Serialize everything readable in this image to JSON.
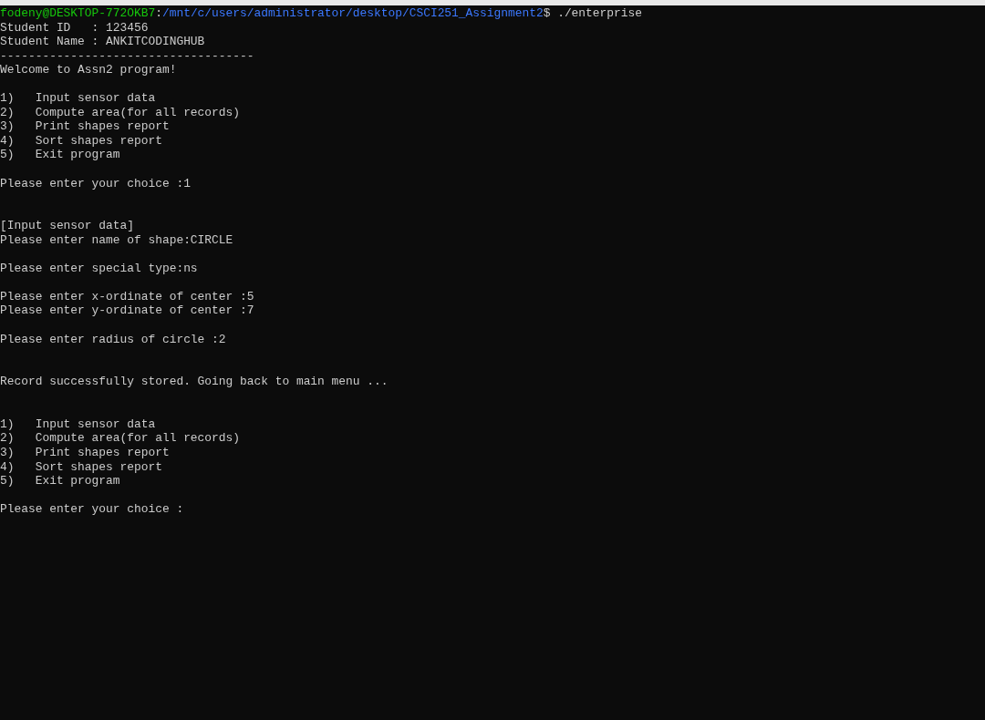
{
  "terminal": {
    "lines": [
      {
        "kind": "prompt",
        "user_host": "fodeny@DESKTOP-772OKB7",
        "separator": ":",
        "path": "/mnt/c/users/administrator/desktop/CSCI251_Assignment2",
        "command": "$ ./enterprise"
      },
      {
        "kind": "text",
        "text": "Student ID   : 123456"
      },
      {
        "kind": "text",
        "text": "Student Name : ANKITCODINGHUB"
      },
      {
        "kind": "text",
        "text": "------------------------------------"
      },
      {
        "kind": "text",
        "text": "Welcome to Assn2 program!"
      },
      {
        "kind": "blank"
      },
      {
        "kind": "text",
        "text": "1)   Input sensor data"
      },
      {
        "kind": "text",
        "text": "2)   Compute area(for all records)"
      },
      {
        "kind": "text",
        "text": "3)   Print shapes report"
      },
      {
        "kind": "text",
        "text": "4)   Sort shapes report"
      },
      {
        "kind": "text",
        "text": "5)   Exit program"
      },
      {
        "kind": "blank"
      },
      {
        "kind": "text",
        "text": "Please enter your choice :1"
      },
      {
        "kind": "blank"
      },
      {
        "kind": "blank"
      },
      {
        "kind": "text",
        "text": "[Input sensor data]"
      },
      {
        "kind": "text",
        "text": "Please enter name of shape:CIRCLE"
      },
      {
        "kind": "blank"
      },
      {
        "kind": "text",
        "text": "Please enter special type:ns"
      },
      {
        "kind": "blank"
      },
      {
        "kind": "text",
        "text": "Please enter x-ordinate of center :5"
      },
      {
        "kind": "text",
        "text": "Please enter y-ordinate of center :7"
      },
      {
        "kind": "blank"
      },
      {
        "kind": "text",
        "text": "Please enter radius of circle :2"
      },
      {
        "kind": "blank"
      },
      {
        "kind": "blank"
      },
      {
        "kind": "text",
        "text": "Record successfully stored. Going back to main menu ..."
      },
      {
        "kind": "blank"
      },
      {
        "kind": "blank"
      },
      {
        "kind": "text",
        "text": "1)   Input sensor data"
      },
      {
        "kind": "text",
        "text": "2)   Compute area(for all records)"
      },
      {
        "kind": "text",
        "text": "3)   Print shapes report"
      },
      {
        "kind": "text",
        "text": "4)   Sort shapes report"
      },
      {
        "kind": "text",
        "text": "5)   Exit program"
      },
      {
        "kind": "blank"
      },
      {
        "kind": "text",
        "text": "Please enter your choice :"
      }
    ]
  }
}
